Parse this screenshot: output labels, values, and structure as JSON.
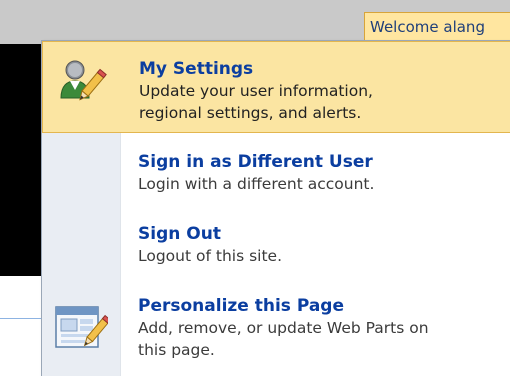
{
  "header": {
    "welcome_text": "Welcome alang"
  },
  "menu": {
    "items": [
      {
        "title": "My Settings",
        "desc_lines": [
          "Update your user information,",
          "regional settings, and alerts."
        ],
        "icon": "user-settings-icon",
        "highlighted": true
      },
      {
        "title": "Sign in as Different User",
        "desc_lines": [
          "Login with a different account."
        ],
        "icon": null,
        "highlighted": false
      },
      {
        "title": "Sign Out",
        "desc_lines": [
          "Logout of this site."
        ],
        "icon": null,
        "highlighted": false
      },
      {
        "title": "Personalize this Page",
        "desc_lines": [
          "Add, remove, or update Web Parts on",
          "this page."
        ],
        "icon": "personalize-page-icon",
        "highlighted": false
      }
    ]
  },
  "colors": {
    "highlight_bg": "#fbe5a2",
    "highlight_border": "#e3b64f",
    "title_blue": "#0b3ea0"
  }
}
